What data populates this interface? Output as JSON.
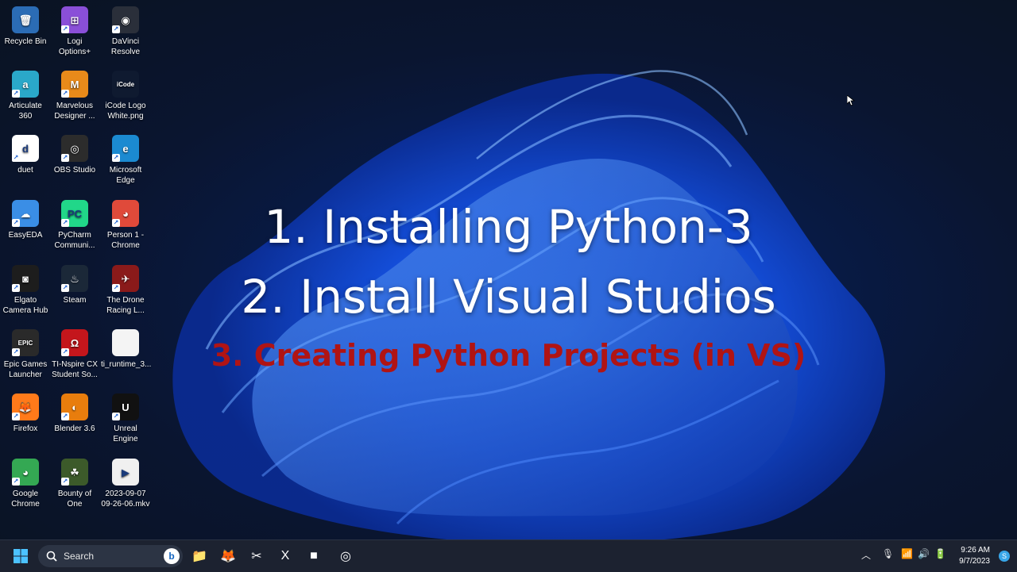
{
  "desktop": {
    "icons": [
      {
        "label": "Recycle Bin",
        "glyph": "🗑",
        "color": "#2b6cb5",
        "icon": "recycle-bin-icon"
      },
      {
        "label": "Logi\nOptions+",
        "glyph": "⊞",
        "color": "#8a4fd8",
        "icon": "logi-options-icon"
      },
      {
        "label": "DaVinci\nResolve",
        "glyph": "◉",
        "color": "#2a2f3a",
        "icon": "davinci-resolve-icon"
      },
      {
        "label": "Articulate\n360",
        "glyph": "a",
        "color": "#2aa8c9",
        "icon": "articulate-360-icon"
      },
      {
        "label": "Marvelous\nDesigner ...",
        "glyph": "M",
        "color": "#e88a1a",
        "icon": "marvelous-designer-icon"
      },
      {
        "label": "iCode Logo\nWhite.png",
        "glyph": "iCode",
        "color": "#0f1a30",
        "icon": "image-file-icon"
      },
      {
        "label": "duet",
        "glyph": "d",
        "color": "#ffffff",
        "icon": "duet-icon"
      },
      {
        "label": "OBS Studio",
        "glyph": "◎",
        "color": "#2c2c2c",
        "icon": "obs-studio-icon"
      },
      {
        "label": "Microsoft\nEdge",
        "glyph": "e",
        "color": "#1b8ad1",
        "icon": "edge-icon"
      },
      {
        "label": "EasyEDA",
        "glyph": "☁",
        "color": "#3a8ee6",
        "icon": "easyeda-icon"
      },
      {
        "label": "PyCharm\nCommuni...",
        "glyph": "PC",
        "color": "#21d789",
        "icon": "pycharm-icon"
      },
      {
        "label": "Person 1 -\nChrome",
        "glyph": "◕",
        "color": "#e04a3a",
        "icon": "chrome-profile-icon"
      },
      {
        "label": "Elgato\nCamera Hub",
        "glyph": "◙",
        "color": "#1d1d1d",
        "icon": "elgato-icon"
      },
      {
        "label": "Steam",
        "glyph": "♨",
        "color": "#1b2838",
        "icon": "steam-icon"
      },
      {
        "label": "The Drone\nRacing L...",
        "glyph": "✈",
        "color": "#8a1a1a",
        "icon": "drone-racing-icon"
      },
      {
        "label": "Epic Games\nLauncher",
        "glyph": "EPIC",
        "color": "#2a2a2a",
        "icon": "epic-games-icon"
      },
      {
        "label": "TI-Nspire CX\nStudent So...",
        "glyph": "Ω",
        "color": "#c4161c",
        "icon": "ti-nspire-icon"
      },
      {
        "label": "ti_runtime_3...",
        "glyph": "",
        "color": "#f4f4f4",
        "icon": "file-icon"
      },
      {
        "label": "Firefox",
        "glyph": "🦊",
        "color": "#ff7a1a",
        "icon": "firefox-icon"
      },
      {
        "label": "Blender 3.6",
        "glyph": "◐",
        "color": "#e87d0d",
        "icon": "blender-icon"
      },
      {
        "label": "Unreal\nEngine",
        "glyph": "U",
        "color": "#111111",
        "icon": "unreal-engine-icon"
      },
      {
        "label": "Google\nChrome",
        "glyph": "◕",
        "color": "#34a853",
        "icon": "chrome-icon"
      },
      {
        "label": "Bounty of\nOne",
        "glyph": "☘",
        "color": "#3c5a2a",
        "icon": "bounty-of-one-icon"
      },
      {
        "label": "2023-09-07\n09-26-06.mkv",
        "glyph": "▶",
        "color": "#f0f0f0",
        "icon": "video-file-icon"
      }
    ]
  },
  "overlay": {
    "line1": "1. Installing Python-3",
    "line2": "2. Install Visual Studios",
    "line3": "3. Creating Python Projects (in VS)"
  },
  "taskbar": {
    "search_placeholder": "Search",
    "bing_glyph": "b",
    "clock_time": "9:26 AM",
    "clock_date": "9/7/2023",
    "apps": [
      {
        "icon": "file-explorer-icon",
        "glyph": "📁"
      },
      {
        "icon": "firefox-icon",
        "glyph": "🦊"
      },
      {
        "icon": "snipping-tool-icon",
        "glyph": "✂"
      },
      {
        "icon": "xbox-icon",
        "glyph": "X"
      },
      {
        "icon": "recording-app-icon",
        "glyph": "■"
      },
      {
        "icon": "obs-studio-icon",
        "glyph": "◎"
      }
    ]
  }
}
